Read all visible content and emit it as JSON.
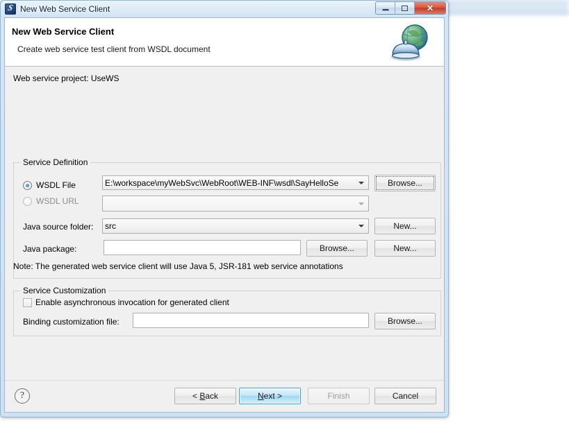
{
  "window": {
    "title": "New Web Service Client",
    "icon": "myeclipse-app-icon",
    "controls": {
      "minimize": "minimize-button",
      "restore": "restore-button",
      "close": "close-button",
      "close_glyph": "✕"
    }
  },
  "header": {
    "title": "New Web Service Client",
    "subtitle": "Create web service test client from WSDL document",
    "icon": "web-service-globe-icon"
  },
  "body": {
    "project_line": "Web service project: UseWS",
    "note": "Note: The generated web service client will use Java 5, JSR-181 web service annotations"
  },
  "service_definition": {
    "legend": "Service Definition",
    "wsdl_file": {
      "label": "WSDL File",
      "selected": true,
      "value": "E:\\workspace\\myWebSvc\\WebRoot\\WEB-INF\\wsdl\\SayHelloSe",
      "browse_label": "Browse..."
    },
    "wsdl_url": {
      "label": "WSDL URL",
      "selected": false,
      "value": ""
    },
    "java_source_folder": {
      "label": "Java source folder:",
      "value": "src",
      "new_label": "New..."
    },
    "java_package": {
      "label": "Java package:",
      "value": "",
      "browse_label": "Browse...",
      "new_label": "New..."
    }
  },
  "service_customization": {
    "legend": "Service Customization",
    "async_checkbox": {
      "label": "Enable asynchronous invocation for generated client",
      "checked": false
    },
    "binding_file": {
      "label": "Binding customization file:",
      "value": "",
      "browse_label": "Browse..."
    }
  },
  "footer": {
    "help_label": "?",
    "back_label": "< Back",
    "back_pre": "< ",
    "back_mnemonic": "B",
    "back_post": "ack",
    "next_pre": "",
    "next_mnemonic": "N",
    "next_post": "ext >",
    "finish_label": "Finish",
    "finish_enabled": false,
    "cancel_label": "Cancel"
  },
  "colors": {
    "accent_default_button": "#9fd7f2",
    "close_button": "#d8543f",
    "dialog_bg": "#f0f0f0",
    "header_bg": "#ffffff"
  }
}
